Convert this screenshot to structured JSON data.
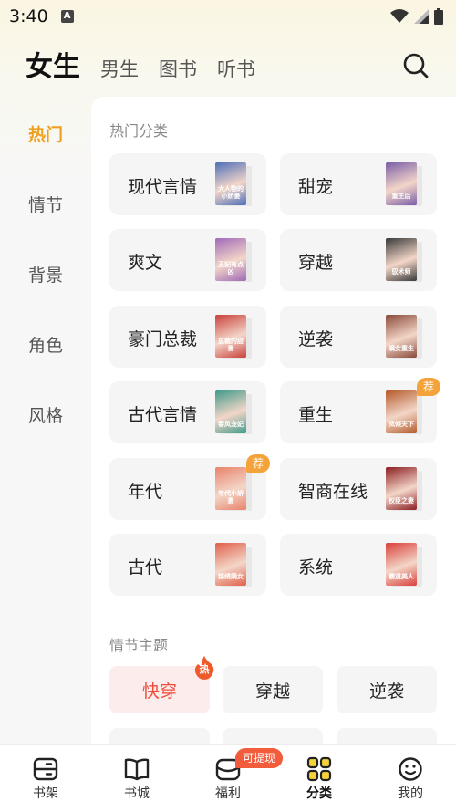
{
  "status_bar": {
    "time": "3:40",
    "notification_glyph": "A"
  },
  "gender_tabs": [
    {
      "label": "女生",
      "active": true
    },
    {
      "label": "男生",
      "active": false
    },
    {
      "label": "图书",
      "active": false
    },
    {
      "label": "听书",
      "active": false
    }
  ],
  "sidebar": {
    "items": [
      {
        "label": "热门",
        "active": true
      },
      {
        "label": "情节",
        "active": false
      },
      {
        "label": "背景",
        "active": false
      },
      {
        "label": "角色",
        "active": false
      },
      {
        "label": "风格",
        "active": false
      }
    ]
  },
  "hot_section": {
    "title": "热门分类",
    "categories": [
      {
        "label": "现代言情",
        "cover_title": "大人物的小娇妻",
        "cover_color": "#4f6fb8",
        "badge": ""
      },
      {
        "label": "甜宠",
        "cover_title": "重生后",
        "cover_color": "#7a5ea8",
        "badge": ""
      },
      {
        "label": "爽文",
        "cover_title": "王妃有点凶",
        "cover_color": "#a06ab8",
        "badge": ""
      },
      {
        "label": "穿越",
        "cover_title": "驭术师",
        "cover_color": "#3a3a3a",
        "badge": ""
      },
      {
        "label": "豪门总裁",
        "cover_title": "总裁的甜妻",
        "cover_color": "#c9413b",
        "badge": ""
      },
      {
        "label": "逆袭",
        "cover_title": "嫡女重生",
        "cover_color": "#8a4a3a",
        "badge": ""
      },
      {
        "label": "古代言情",
        "cover_title": "春风宠妃",
        "cover_color": "#3f9a8a",
        "badge": ""
      },
      {
        "label": "重生",
        "cover_title": "凤倾天下",
        "cover_color": "#b55a2a",
        "badge": "荐"
      },
      {
        "label": "年代",
        "cover_title": "年代小娇妻",
        "cover_color": "#e8836b",
        "badge": "荐"
      },
      {
        "label": "智商在线",
        "cover_title": "权臣之妻",
        "cover_color": "#8c1f22",
        "badge": ""
      },
      {
        "label": "古代",
        "cover_title": "锦绣嫡女",
        "cover_color": "#e0604a",
        "badge": ""
      },
      {
        "label": "系统",
        "cover_title": "霸道美人",
        "cover_color": "#d9403a",
        "badge": ""
      }
    ]
  },
  "plot_section": {
    "title": "情节主题",
    "tags": [
      {
        "label": "快穿",
        "active": true,
        "badge": "热"
      },
      {
        "label": "穿越",
        "active": false,
        "badge": ""
      },
      {
        "label": "逆袭",
        "active": false,
        "badge": ""
      }
    ]
  },
  "bottom_nav": [
    {
      "label": "书架",
      "icon": "bookshelf-icon",
      "active": false,
      "badge": ""
    },
    {
      "label": "书城",
      "icon": "book-open-icon",
      "active": false,
      "badge": ""
    },
    {
      "label": "福利",
      "icon": "gift-box-icon",
      "active": false,
      "badge": "可提现"
    },
    {
      "label": "分类",
      "icon": "category-grid-icon",
      "active": true,
      "badge": ""
    },
    {
      "label": "我的",
      "icon": "smiley-profile-icon",
      "active": false,
      "badge": ""
    }
  ],
  "colors": {
    "accent": "#f0a020",
    "brand_yellow": "#f6d23a",
    "hot_red": "#ee4b3b",
    "badge_orange": "#f4a33b"
  }
}
